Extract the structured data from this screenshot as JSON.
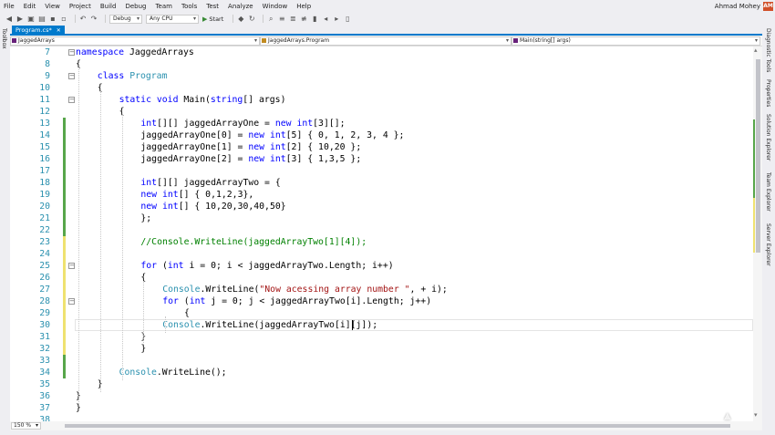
{
  "menu": [
    "File",
    "Edit",
    "View",
    "Project",
    "Build",
    "Debug",
    "Team",
    "Tools",
    "Test",
    "Analyze",
    "Window",
    "Help"
  ],
  "user": {
    "name": "Ahmad Mohey",
    "initials": "AM"
  },
  "toolbar": {
    "config": "Debug",
    "platform": "Any CPU",
    "start": "Start"
  },
  "side_left": "Toolbox",
  "side_right": [
    "Diagnostic Tools",
    "Properties",
    "Solution Explorer",
    "Team Explorer",
    "Server Explorer"
  ],
  "tab": {
    "label": "Program.cs*"
  },
  "nav": {
    "project": "JaggedArrays",
    "class": "JaggedArrays.Program",
    "member": "Main(string[] args)"
  },
  "editor": {
    "lines": [
      {
        "n": "7",
        "tokens": [
          [
            "kw",
            "namespace"
          ],
          [
            "",
            "JaggedArrays"
          ]
        ]
      },
      {
        "n": "8",
        "tokens": [
          [
            "",
            "{"
          ]
        ]
      },
      {
        "n": "9",
        "tokens": [
          [
            "kw",
            "class"
          ],
          [
            "ty",
            "Program"
          ]
        ]
      },
      {
        "n": "10",
        "tokens": [
          [
            "",
            "{"
          ]
        ]
      },
      {
        "n": "11",
        "tokens": [
          [
            "kw",
            "static"
          ],
          [
            "kw",
            "void"
          ],
          [
            "",
            "Main("
          ],
          [
            "kw",
            "string"
          ],
          [
            "",
            "[] args)"
          ]
        ]
      },
      {
        "n": "12",
        "tokens": [
          [
            "",
            "{"
          ]
        ]
      },
      {
        "n": "13",
        "tokens": [
          [
            "kw",
            "int"
          ],
          [
            "",
            "[][] jaggedArrayOne = "
          ],
          [
            "kw",
            "new"
          ],
          [
            "kw",
            "int"
          ],
          [
            "",
            "[3][];"
          ]
        ]
      },
      {
        "n": "14",
        "tokens": [
          [
            "",
            "jaggedArrayOne[0] = "
          ],
          [
            "kw",
            "new"
          ],
          [
            "kw",
            "int"
          ],
          [
            "",
            "[5] { 0, 1, 2, 3, 4 };"
          ]
        ]
      },
      {
        "n": "15",
        "tokens": [
          [
            "",
            "jaggedArrayOne[1] = "
          ],
          [
            "kw",
            "new"
          ],
          [
            "kw",
            "int"
          ],
          [
            "",
            "[2] { 10,20 };"
          ]
        ]
      },
      {
        "n": "16",
        "tokens": [
          [
            "",
            "jaggedArrayOne[2] = "
          ],
          [
            "kw",
            "new"
          ],
          [
            "kw",
            "int"
          ],
          [
            "",
            "[3] { 1,3,5 };"
          ]
        ]
      },
      {
        "n": "17",
        "tokens": []
      },
      {
        "n": "18",
        "tokens": [
          [
            "kw",
            "int"
          ],
          [
            "",
            "[][] jaggedArrayTwo = {"
          ]
        ]
      },
      {
        "n": "19",
        "tokens": [
          [
            "kw",
            "new"
          ],
          [
            "kw",
            "int"
          ],
          [
            "",
            "[] { 0,1,2,3},"
          ]
        ]
      },
      {
        "n": "20",
        "tokens": [
          [
            "kw",
            "new"
          ],
          [
            "kw",
            "int"
          ],
          [
            "",
            "[] { 10,20,30,40,50}"
          ]
        ]
      },
      {
        "n": "21",
        "tokens": [
          [
            "",
            "};"
          ]
        ]
      },
      {
        "n": "22",
        "tokens": []
      },
      {
        "n": "23",
        "tokens": [
          [
            "cm",
            "//Console.WriteLine(jaggedArrayTwo[1][4]);"
          ]
        ]
      },
      {
        "n": "24",
        "tokens": []
      },
      {
        "n": "25",
        "tokens": [
          [
            "kw",
            "for"
          ],
          [
            "",
            "("
          ],
          [
            "kw",
            "int"
          ],
          [
            "",
            "i = 0; i < jaggedArrayTwo.Length; i++)"
          ]
        ]
      },
      {
        "n": "26",
        "tokens": [
          [
            "",
            "{"
          ]
        ]
      },
      {
        "n": "27",
        "tokens": [
          [
            "ty",
            "Console"
          ],
          [
            "",
            ".WriteLine("
          ],
          [
            "st",
            "\"Now acessing array number \""
          ],
          [
            "",
            ", + i);"
          ]
        ]
      },
      {
        "n": "28",
        "tokens": [
          [
            "kw",
            "for"
          ],
          [
            "",
            "("
          ],
          [
            "kw",
            "int"
          ],
          [
            "",
            "j = 0; j < jaggedArrayTwo[i].Length; j++)"
          ]
        ]
      },
      {
        "n": "29",
        "tokens": [
          [
            "",
            "{"
          ]
        ]
      },
      {
        "n": "30",
        "tokens": [
          [
            "ty",
            "Console"
          ],
          [
            "",
            ".WriteLine(jaggedArrayTwo[i][j]);"
          ]
        ]
      },
      {
        "n": "31",
        "tokens": [
          [
            "",
            "}"
          ]
        ]
      },
      {
        "n": "32",
        "tokens": [
          [
            "",
            "}"
          ]
        ]
      },
      {
        "n": "33",
        "tokens": []
      },
      {
        "n": "34",
        "tokens": [
          [
            "ty",
            "Console"
          ],
          [
            "",
            ".WriteLine();"
          ]
        ]
      },
      {
        "n": "35",
        "tokens": [
          [
            "",
            "}"
          ]
        ]
      },
      {
        "n": "36",
        "tokens": [
          [
            "",
            "}"
          ]
        ]
      },
      {
        "n": "37",
        "tokens": [
          [
            "",
            "}"
          ]
        ]
      },
      {
        "n": "38",
        "tokens": []
      }
    ]
  },
  "zoom": "150 %",
  "colors": {
    "accent": "#007acc",
    "keyword": "#0000ff",
    "type": "#2b91af",
    "comment": "#008000",
    "string": "#a31515",
    "saved_change": "#57a64a",
    "unsaved_change": "#efe270"
  }
}
